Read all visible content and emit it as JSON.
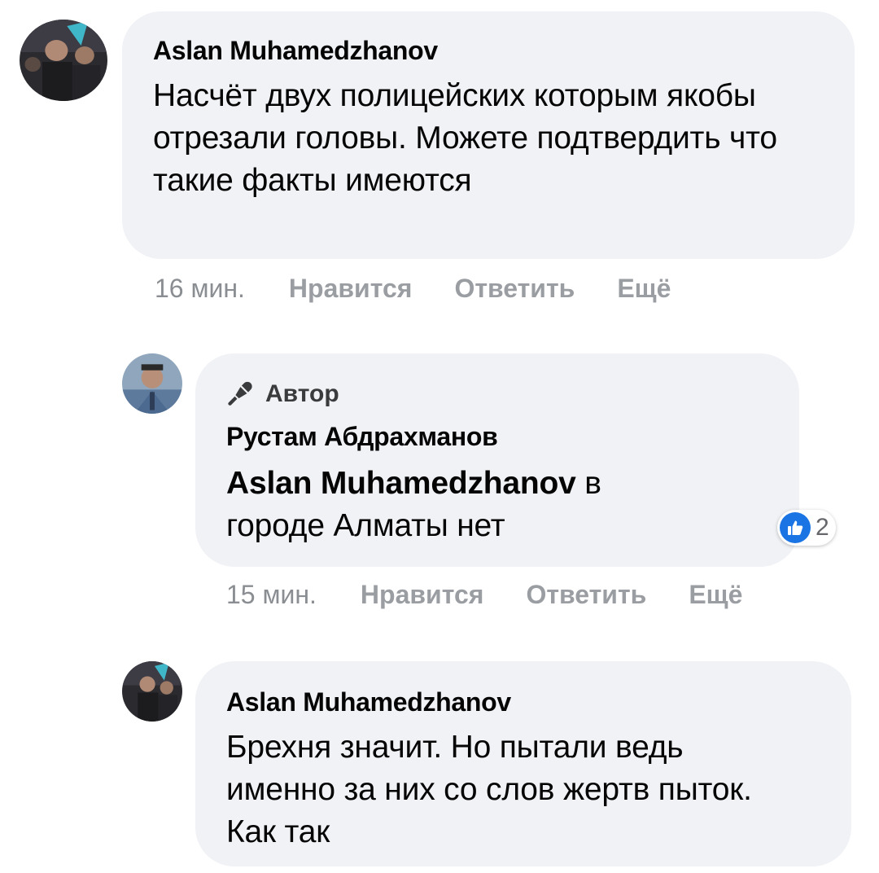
{
  "comments": [
    {
      "author": "Aslan Muhamedzhanov",
      "text": "Насчёт двух полицейских которым якобы отрезали головы. Можете подтвердить что такие факты имеются",
      "time": "16 мин.",
      "actions": [
        "Нравится",
        "Ответить",
        "Ещё"
      ]
    },
    {
      "badge": "Автор",
      "author": "Рустам Абдрахманов",
      "mention": "Aslan Muhamedzhanov",
      "text": " в городе Алматы нет",
      "time": "15 мин.",
      "actions": [
        "Нравится",
        "Ответить",
        "Ещё"
      ],
      "reaction": {
        "icon": "thumbs-up-icon",
        "count": "2"
      }
    },
    {
      "author": "Aslan Muhamedzhanov",
      "text": "Брехня значит. Но пытали ведь именно за них со слов жертв пыток. Как так"
    }
  ],
  "colors": {
    "bubble": "#f0f2f5",
    "like_blue": "#1b74e4",
    "meta_gray": "#8a8d91"
  }
}
